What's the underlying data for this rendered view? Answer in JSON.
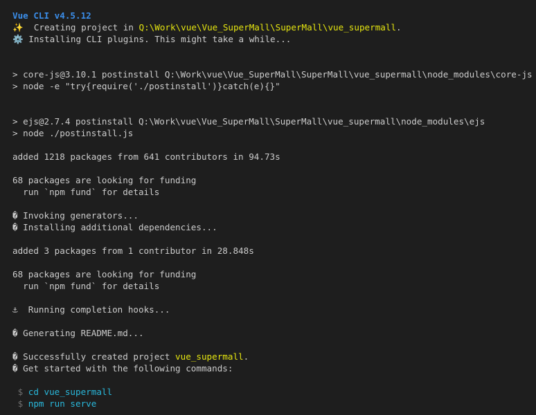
{
  "header": {
    "title": "Vue CLI v4.5.12"
  },
  "creating": {
    "icon": "✨",
    "text": "  Creating project in ",
    "path": "Q:\\Work\\vue\\Vue_SuperMall\\SuperMall\\vue_supermall",
    "suffix": "."
  },
  "installing": {
    "icon": "⚙️",
    "text": " Installing CLI plugins. This might take a while..."
  },
  "corejs": {
    "line1": "> core-js@3.10.1 postinstall Q:\\Work\\vue\\Vue_SuperMall\\SuperMall\\vue_supermall\\node_modules\\core-js",
    "line2": "> node -e \"try{require('./postinstall')}catch(e){}\""
  },
  "ejs": {
    "line1": "> ejs@2.7.4 postinstall Q:\\Work\\vue\\Vue_SuperMall\\SuperMall\\vue_supermall\\node_modules\\ejs",
    "line2": "> node ./postinstall.js"
  },
  "added1": "added 1218 packages from 641 contributors in 94.73s",
  "funding1": {
    "line1": "68 packages are looking for funding",
    "line2": "  run `npm fund` for details"
  },
  "invoking": "� Invoking generators...",
  "installing_deps": "� Installing additional dependencies...",
  "added2": "added 3 packages from 1 contributor in 28.848s",
  "funding2": {
    "line1": "68 packages are looking for funding",
    "line2": "  run `npm fund` for details"
  },
  "hooks": {
    "icon": "⚓",
    "text": "  Running completion hooks..."
  },
  "readme": "� Generating README.md...",
  "success": {
    "prefix": "� Successfully created project ",
    "name": "vue_supermall",
    "suffix": "."
  },
  "getstarted": "� Get started with the following commands:",
  "commands": [
    {
      "prompt": " $ ",
      "cmd": "cd vue_supermall"
    },
    {
      "prompt": " $ ",
      "cmd": "npm run serve"
    }
  ]
}
